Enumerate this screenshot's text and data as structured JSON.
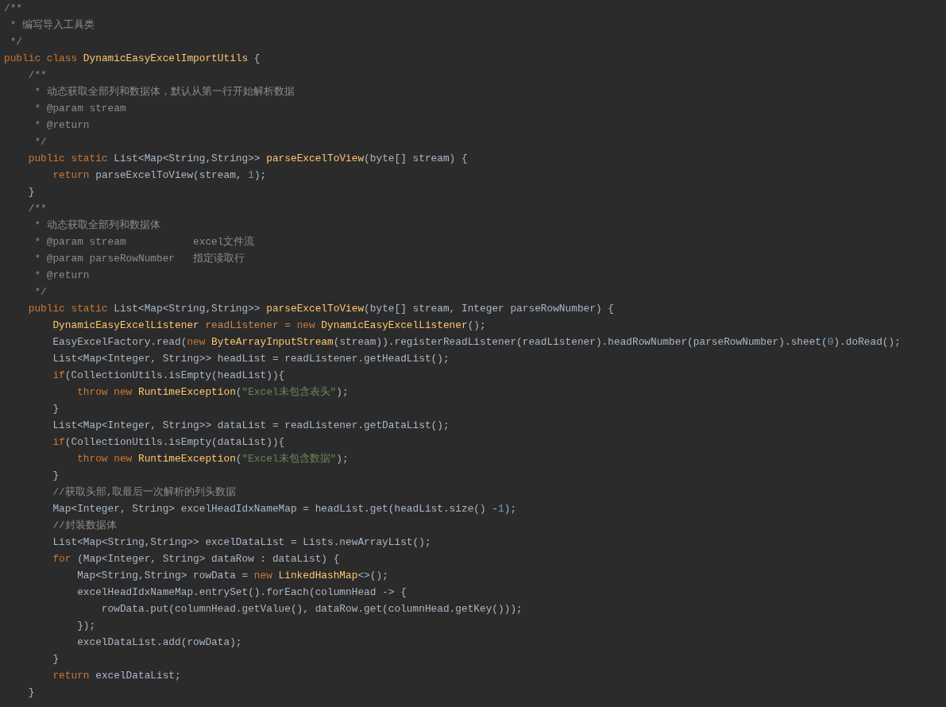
{
  "editor": {
    "lines": [
      [
        {
          "kind": "comment",
          "text": "/**"
        }
      ],
      [
        {
          "kind": "comment",
          "text": " * 编写导入工具类"
        }
      ],
      [
        {
          "kind": "comment",
          "text": " */"
        }
      ],
      [
        {
          "kind": "keyword",
          "text": "public class "
        },
        {
          "kind": "function",
          "text": "DynamicEasyExcelImportUtils"
        },
        {
          "kind": "plain",
          "text": " {"
        }
      ],
      [
        {
          "kind": "comment",
          "text": "    /**"
        }
      ],
      [
        {
          "kind": "comment",
          "text": "     * 动态获取全部列和数据体，默认从第一行开始解析数据"
        }
      ],
      [
        {
          "kind": "comment",
          "text": "     * @param stream"
        }
      ],
      [
        {
          "kind": "comment",
          "text": "     * @return"
        }
      ],
      [
        {
          "kind": "comment",
          "text": "     */"
        }
      ],
      [
        {
          "kind": "keyword",
          "text": "    public static "
        },
        {
          "kind": "plain",
          "text": "List<Map<String,String>> "
        },
        {
          "kind": "function",
          "text": "parseExcelToView"
        },
        {
          "kind": "plain",
          "text": "(byte[] stream) {"
        }
      ],
      [
        {
          "kind": "keyword",
          "text": "        return "
        },
        {
          "kind": "plain",
          "text": "parseExcelToView(stream, "
        },
        {
          "kind": "number",
          "text": "1"
        },
        {
          "kind": "plain",
          "text": ");"
        }
      ],
      [
        {
          "kind": "plain",
          "text": "    }"
        }
      ],
      [
        {
          "kind": "comment",
          "text": "    /**"
        }
      ],
      [
        {
          "kind": "comment",
          "text": "     * 动态获取全部列和数据体"
        }
      ],
      [
        {
          "kind": "comment",
          "text": "     * @param stream           excel文件流"
        }
      ],
      [
        {
          "kind": "comment",
          "text": "     * @param parseRowNumber   指定读取行"
        }
      ],
      [
        {
          "kind": "comment",
          "text": "     * @return"
        }
      ],
      [
        {
          "kind": "comment",
          "text": "     */"
        }
      ],
      [
        {
          "kind": "keyword",
          "text": "    public static "
        },
        {
          "kind": "plain",
          "text": "List<Map<String,String>> "
        },
        {
          "kind": "function",
          "text": "parseExcelToView"
        },
        {
          "kind": "plain",
          "text": "(byte[] stream, Integer parseRowNumber) {"
        }
      ],
      [
        {
          "kind": "function",
          "text": "        DynamicEasyExcelListener "
        },
        {
          "kind": "variable",
          "text": "readListener = "
        },
        {
          "kind": "keyword",
          "text": "new "
        },
        {
          "kind": "function",
          "text": "DynamicEasyExcelListener"
        },
        {
          "kind": "plain",
          "text": "();"
        }
      ],
      [
        {
          "kind": "plain",
          "text": "        EasyExcelFactory.read("
        },
        {
          "kind": "keyword",
          "text": "new "
        },
        {
          "kind": "function",
          "text": "ByteArrayInputStream"
        },
        {
          "kind": "plain",
          "text": "(stream)).registerReadListener(readListener).headRowNumber(parseRowNumber).sheet("
        },
        {
          "kind": "number",
          "text": "0"
        },
        {
          "kind": "plain",
          "text": ").doRead();"
        }
      ],
      [
        {
          "kind": "plain",
          "text": "        List<Map<Integer, String>> headList = readListener.getHeadList();"
        }
      ],
      [
        {
          "kind": "keyword",
          "text": "        if"
        },
        {
          "kind": "plain",
          "text": "(CollectionUtils.isEmpty(headList)){"
        }
      ],
      [
        {
          "kind": "keyword",
          "text": "            throw new "
        },
        {
          "kind": "function",
          "text": "RuntimeException"
        },
        {
          "kind": "plain",
          "text": "("
        },
        {
          "kind": "string",
          "text": "\"Excel未包含表头\""
        },
        {
          "kind": "plain",
          "text": ");"
        }
      ],
      [
        {
          "kind": "plain",
          "text": "        }"
        }
      ],
      [
        {
          "kind": "plain",
          "text": "        List<Map<Integer, String>> dataList = readListener.getDataList();"
        }
      ],
      [
        {
          "kind": "keyword",
          "text": "        if"
        },
        {
          "kind": "plain",
          "text": "(CollectionUtils.isEmpty(dataList)){"
        }
      ],
      [
        {
          "kind": "keyword",
          "text": "            throw new "
        },
        {
          "kind": "function",
          "text": "RuntimeException"
        },
        {
          "kind": "plain",
          "text": "("
        },
        {
          "kind": "string",
          "text": "\"Excel未包含数据\""
        },
        {
          "kind": "plain",
          "text": ");"
        }
      ],
      [
        {
          "kind": "plain",
          "text": "        }"
        }
      ],
      [
        {
          "kind": "comment",
          "text": "        //获取头部,取最后一次解析的列头数据"
        }
      ],
      [
        {
          "kind": "plain",
          "text": "        Map<Integer, String> excelHeadIdxNameMap = headList.get(headList.size() -"
        },
        {
          "kind": "number",
          "text": "1"
        },
        {
          "kind": "plain",
          "text": ");"
        }
      ],
      [
        {
          "kind": "comment",
          "text": "        //封装数据体"
        }
      ],
      [
        {
          "kind": "plain",
          "text": "        List<Map<String,String>> excelDataList = Lists.newArrayList();"
        }
      ],
      [
        {
          "kind": "keyword",
          "text": "        for "
        },
        {
          "kind": "plain",
          "text": "(Map<Integer, String> dataRow : dataList) {"
        }
      ],
      [
        {
          "kind": "plain",
          "text": "            Map<String,String> rowData = "
        },
        {
          "kind": "keyword",
          "text": "new "
        },
        {
          "kind": "function",
          "text": "LinkedHashMap"
        },
        {
          "kind": "plain",
          "text": "<>();"
        }
      ],
      [
        {
          "kind": "plain",
          "text": "            excelHeadIdxNameMap.entrySet().forEach(columnHead -> {"
        }
      ],
      [
        {
          "kind": "plain",
          "text": "                rowData.put(columnHead.getValue(), dataRow.get(columnHead.getKey()));"
        }
      ],
      [
        {
          "kind": "plain",
          "text": "            });"
        }
      ],
      [
        {
          "kind": "plain",
          "text": "            excelDataList.add(rowData);"
        }
      ],
      [
        {
          "kind": "plain",
          "text": "        }"
        }
      ],
      [
        {
          "kind": "keyword",
          "text": "        return "
        },
        {
          "kind": "plain",
          "text": "excelDataList;"
        }
      ],
      [
        {
          "kind": "plain",
          "text": "    }"
        }
      ]
    ]
  }
}
